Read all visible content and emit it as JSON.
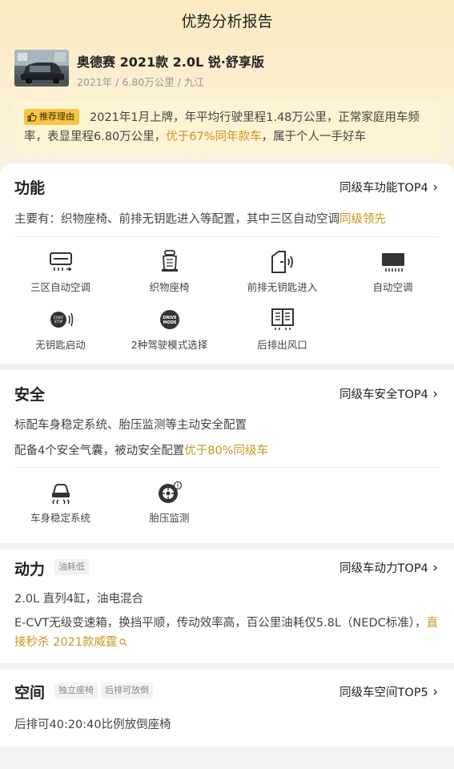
{
  "header": {
    "title": "优势分析报告"
  },
  "car": {
    "name": "奥德赛 2021款 2.0L 锐·舒享版",
    "meta": "2021年 / 6.80万公里 / 九江"
  },
  "reason": {
    "badge": "推荐理由",
    "text_part1": "2021年1月上牌，年平均行驶里程1.48万公里，正常家庭用车频率，表显里程6.80万公里，",
    "text_highlight": "优于67%同年款车",
    "text_part2": "，属于个人一手好车"
  },
  "function": {
    "title": "功能",
    "rank": "同级车功能TOP4",
    "summary_part1": "主要有：织物座椅、前排无钥匙进入等配置，其中三区自动空调",
    "summary_highlight": "同级领先",
    "features": [
      {
        "label": "三区自动空调",
        "icon": "tri-zone-ac-icon"
      },
      {
        "label": "织物座椅",
        "icon": "fabric-seat-icon"
      },
      {
        "label": "前排无钥匙进入",
        "icon": "keyless-entry-icon"
      },
      {
        "label": "自动空调",
        "icon": "auto-ac-icon"
      },
      {
        "label": "无钥匙启动",
        "icon": "start-stop-icon"
      },
      {
        "label": "2种驾驶模式选择",
        "icon": "drive-mode-icon"
      },
      {
        "label": "后排出风口",
        "icon": "rear-vent-icon"
      }
    ]
  },
  "safety": {
    "title": "安全",
    "rank": "同级车安全TOP4",
    "line1": "标配车身稳定系统、胎压监测等主动安全配置",
    "line2_part1": "配备4个安全气囊，被动安全配置",
    "line2_highlight": "优于80%同级车",
    "features": [
      {
        "label": "车身稳定系统",
        "icon": "stability-control-icon"
      },
      {
        "label": "胎压监测",
        "icon": "tire-pressure-icon"
      }
    ]
  },
  "power": {
    "title": "动力",
    "tag": "油耗低",
    "rank": "同级车动力TOP4",
    "line1": "2.0L 直列4缸，油电混合",
    "para_part1": "E-CVT无级变速箱，换挡平顺，传动效率高，百公里油耗仅5.8L（NEDC标准），",
    "para_highlight": "直接秒杀 2021款威霆"
  },
  "space": {
    "title": "空间",
    "tags": [
      "独立座椅",
      "后排可放倒"
    ],
    "rank": "同级车空间TOP5",
    "line1": "后排可40:20:40比例放倒座椅"
  },
  "colors": {
    "accent": "#c99520",
    "badge": "#f7c542",
    "header_bg": "#fbeac0"
  }
}
